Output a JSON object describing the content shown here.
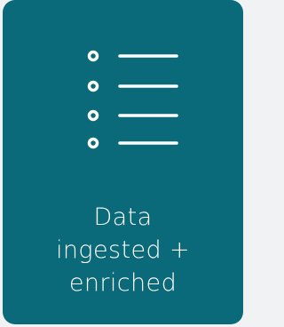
{
  "card": {
    "lines": [
      "Data",
      "ingested +",
      "enriched"
    ],
    "icon": "bulleted-list-icon",
    "colors": {
      "card_background": "#0a6a7a",
      "foreground": "#ffffff",
      "page_background": "#f1f2f3"
    }
  }
}
